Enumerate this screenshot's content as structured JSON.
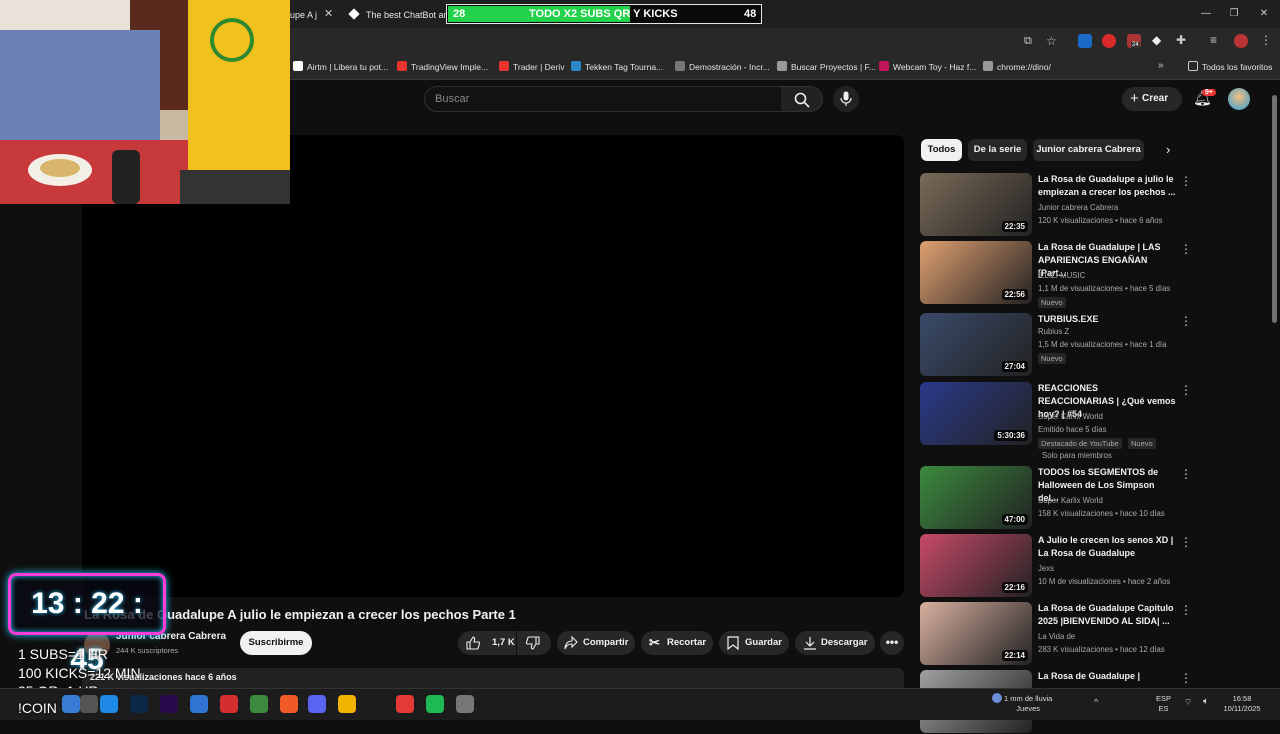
{
  "browser": {
    "tabs": [
      {
        "label": "upe A j"
      },
      {
        "label": "The best ChatBot and"
      }
    ],
    "bookmarks": [
      {
        "label": "Airtm | Libera tu pot...",
        "color": "#ffffff"
      },
      {
        "label": "TradingView Imple...",
        "color": "#e8342c"
      },
      {
        "label": "Trader | Deriv",
        "color": "#e8342c"
      },
      {
        "label": "Tekken Tag Tourna...",
        "color": "#2b86c5"
      },
      {
        "label": "Demostración - Incr...",
        "color": "#777777"
      },
      {
        "label": "Buscar Proyectos | F...",
        "color": "#999999"
      },
      {
        "label": "Webcam Toy - Haz f...",
        "color": "#c2185b"
      },
      {
        "label": "chrome://dino/",
        "color": "#999999"
      }
    ],
    "all_bookmarks": "Todos los favoritos",
    "ext_badge": "24"
  },
  "stream_overlay": {
    "left_count": "28",
    "goal_text": "TODO X2 SUBS QR Y KICKS",
    "right_count": "48",
    "goal_fraction": 0.58,
    "timer": "13 : 22 : 45",
    "lines": [
      "1 SUBS=1 HR",
      "100 KICKS=12 MIN",
      "35 QR=1 HR",
      "!COIN"
    ]
  },
  "youtube": {
    "search_placeholder": "Buscar",
    "create_label": "Crear",
    "notif_badge": "9+",
    "video_title": "La Rosa de Guadalupe A julio le empiezan a crecer los pechos Parte 1",
    "channel_name": "Junior cabrera Cabrera",
    "subscribers": "244 K suscriptores",
    "subscribe_label": "Suscribirme",
    "likes": "1,7 K",
    "share_label": "Compartir",
    "clip_label": "Recortar",
    "save_label": "Guardar",
    "download_label": "Descargar",
    "description_meta": "221 K visualizaciones  hace 6 años",
    "chips": [
      "Todos",
      "De la serie",
      "Junior cabrera Cabrera"
    ],
    "recommendations": [
      {
        "title": "La Rosa de Guadalupe  a julio le empiezan a crecer los pechos ...",
        "channel": "Junior cabrera Cabrera",
        "meta": "120 K visualizaciones • hace 6 años",
        "duration": "22:35",
        "badge": "",
        "thumb": "#7a6a58"
      },
      {
        "title": "La Rosa de Guadalupe | LAS APARIENCIAS ENGAÑAN [Part...",
        "channel": "ILLIZI MUSIC",
        "meta": "1,1 M de visualizaciones • hace 5 días",
        "duration": "22:56",
        "badge": "Nuevo",
        "thumb": "#e0a070"
      },
      {
        "title": "TURBIUS.EXE",
        "channel": "Rubius Z",
        "meta": "1,5 M de visualizaciones • hace 1 día",
        "duration": "27:04",
        "badge": "Nuevo",
        "thumb": "#3a4a6a"
      },
      {
        "title": "REACCIONES REACCIONARIAS | ¿Qué vemos hoy? | #54",
        "channel": "Super Karlix World",
        "meta": "Emitido hace 5 días",
        "duration": "5:30:36",
        "badge": "Destacado de YouTube",
        "badge2": "Nuevo",
        "members": "Solo para miembros",
        "thumb": "#2a3a8a"
      },
      {
        "title": "TODOS los SEGMENTOS de Halloween de Los Simpson del...",
        "channel": "Super Karlix World",
        "meta": "158 K visualizaciones • hace 10 días",
        "duration": "47:00",
        "badge": "",
        "thumb": "#3b8a3e"
      },
      {
        "title": "A Julio le crecen los senos XD | La Rosa de Guadalupe",
        "channel": "Jexs",
        "meta": "10 M de visualizaciones • hace 2 años",
        "duration": "22:16",
        "badge": "",
        "thumb": "#c84a6a"
      },
      {
        "title": "La Rosa de Guadalupe Capitulo 2025 |BIENVENIDO AL SIDA| ...",
        "channel": "La Vida de",
        "meta": "283 K visualizaciones • hace 12 días",
        "duration": "22:14",
        "badge": "",
        "thumb": "#d8b0a0"
      },
      {
        "title": "La Rosa de Guadalupe |",
        "channel": "",
        "meta": "",
        "duration": "",
        "badge": "",
        "thumb": "#a0a0a0"
      }
    ]
  },
  "taskbar": {
    "weather": "1 mm de lluvia",
    "weather_day": "Jueves",
    "lang": "ESP",
    "lang2": "ES",
    "time": "16:58",
    "date": "10/11/2025"
  }
}
